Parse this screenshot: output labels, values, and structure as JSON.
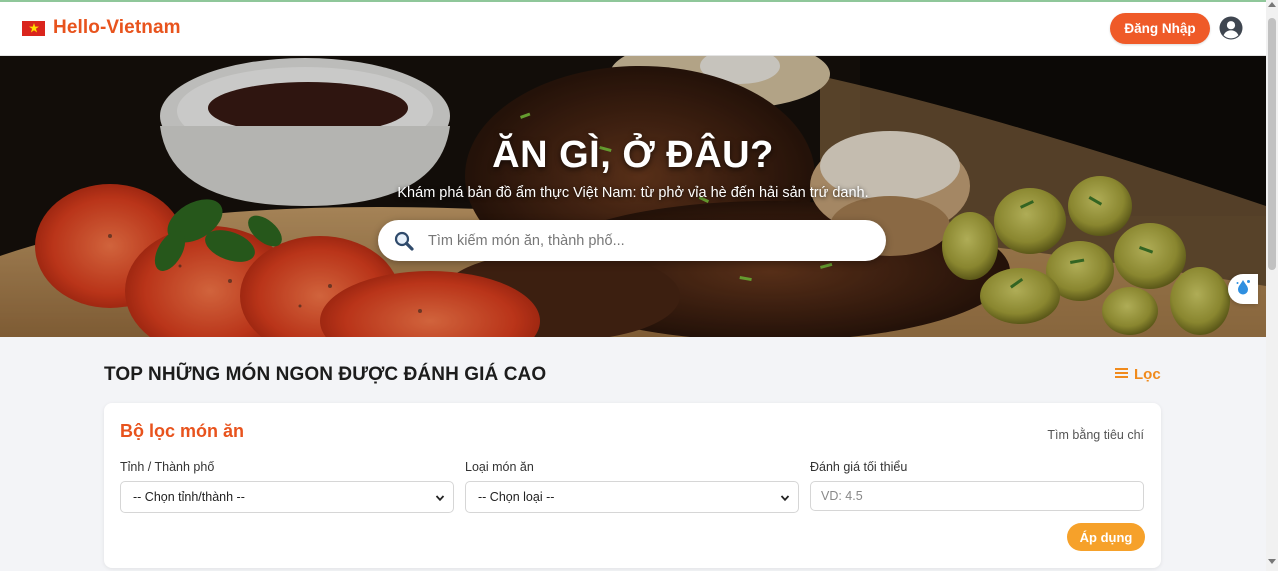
{
  "header": {
    "brand_name": "Hello-Vietnam",
    "login_label": "Đăng Nhập"
  },
  "hero": {
    "title": "ĂN GÌ, Ở ĐÂU?",
    "subtitle": "Khám phá bản đồ ẩm thực Việt Nam: từ phở vỉa hè đến hải sản trứ danh.",
    "search_placeholder": "Tìm kiếm món ăn, thành phố..."
  },
  "section": {
    "title": "TOP NHỮNG MÓN NGON ĐƯỢC ĐÁNH GIÁ CAO",
    "filter_toggle_label": "Lọc"
  },
  "filter": {
    "title": "Bộ lọc món ăn",
    "hint": "Tìm bằng tiêu chí",
    "province_label": "Tỉnh / Thành phố",
    "province_value": "-- Chọn tỉnh/thành --",
    "type_label": "Loại món ăn",
    "type_value": "-- Chọn loại --",
    "rating_label": "Đánh giá tối thiểu",
    "rating_placeholder": "VD: 4.5",
    "apply_label": "Áp dụng"
  },
  "icons": {
    "flag": "vietnam-flag-icon",
    "user": "user-circle-icon",
    "search": "search-icon",
    "filter": "list-filter-icon",
    "floating": "water-drop-icon"
  },
  "colors": {
    "brand": "#e8531d",
    "login_button": "#ef5a28",
    "filter_accent": "#f08a1c",
    "apply_button": "#f6a12a"
  }
}
